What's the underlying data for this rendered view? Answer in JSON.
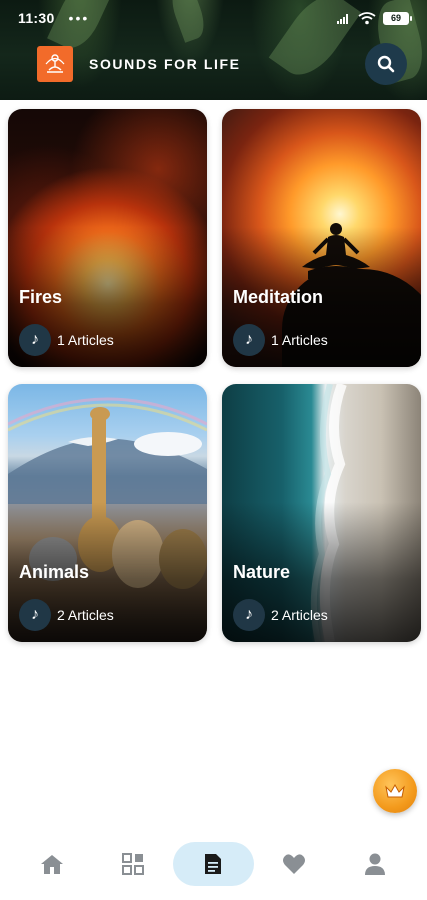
{
  "status_bar": {
    "time": "11:30",
    "more": "•••",
    "battery": "69"
  },
  "app_bar": {
    "title": "SOUNDS FOR LIFE",
    "logo_icon": "meditation-logo-icon",
    "search_icon": "search-icon"
  },
  "categories": [
    {
      "title": "Fires",
      "count_label": "1 Articles",
      "icon": "music-note-icon"
    },
    {
      "title": "Meditation",
      "count_label": "1 Articles",
      "icon": "music-note-icon"
    },
    {
      "title": "Animals",
      "count_label": "2 Articles",
      "icon": "music-note-icon"
    },
    {
      "title": "Nature",
      "count_label": "2 Articles",
      "icon": "music-note-icon"
    }
  ],
  "floating_button": {
    "icon": "crown-icon"
  },
  "bottom_nav": {
    "items": [
      {
        "icon": "home-icon",
        "active": false
      },
      {
        "icon": "grid-icon",
        "active": false
      },
      {
        "icon": "document-icon",
        "active": true
      },
      {
        "icon": "heart-icon",
        "active": false
      },
      {
        "icon": "person-icon",
        "active": false
      }
    ]
  },
  "colors": {
    "accent": "#f26b2a",
    "search_button": "#1e3a4b",
    "note_circle": "#203746",
    "nav_active": "#d6ecf8",
    "nav_icon": "#8a8f94",
    "nav_icon_active": "#1a1a1a",
    "crown": "#f39a1c"
  }
}
